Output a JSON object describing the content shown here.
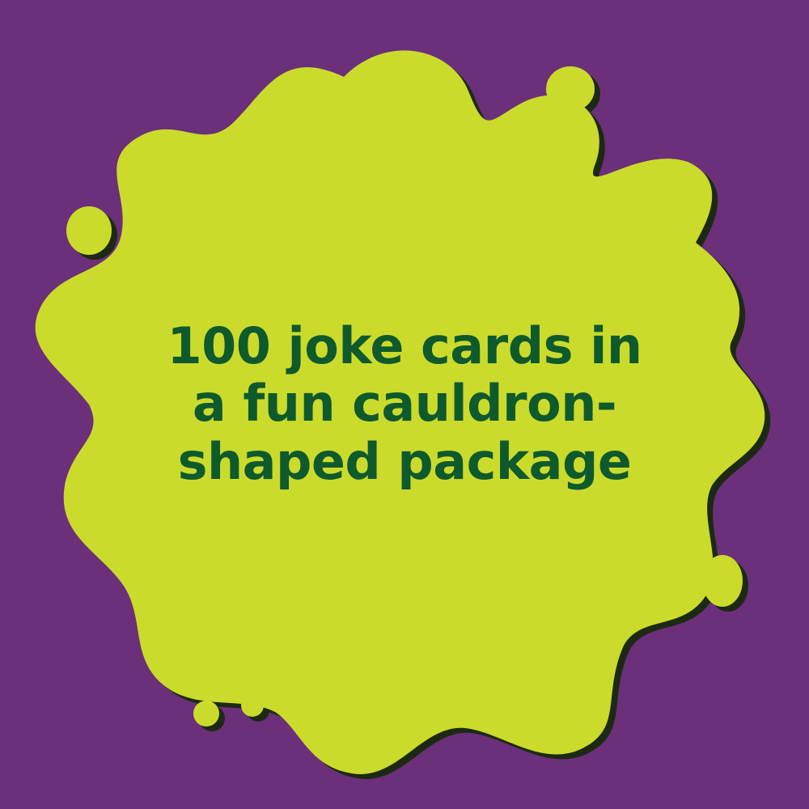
{
  "colors": {
    "background": "#6b3079",
    "splat": "#cbdb2c",
    "splat_shadow": "#1c2a14",
    "text": "#0f5a2c"
  },
  "graphic": {
    "shape": "slime-splat-icon"
  },
  "headline": {
    "lines": [
      "100 joke cards in",
      "a fun cauldron-",
      "shaped package"
    ]
  }
}
